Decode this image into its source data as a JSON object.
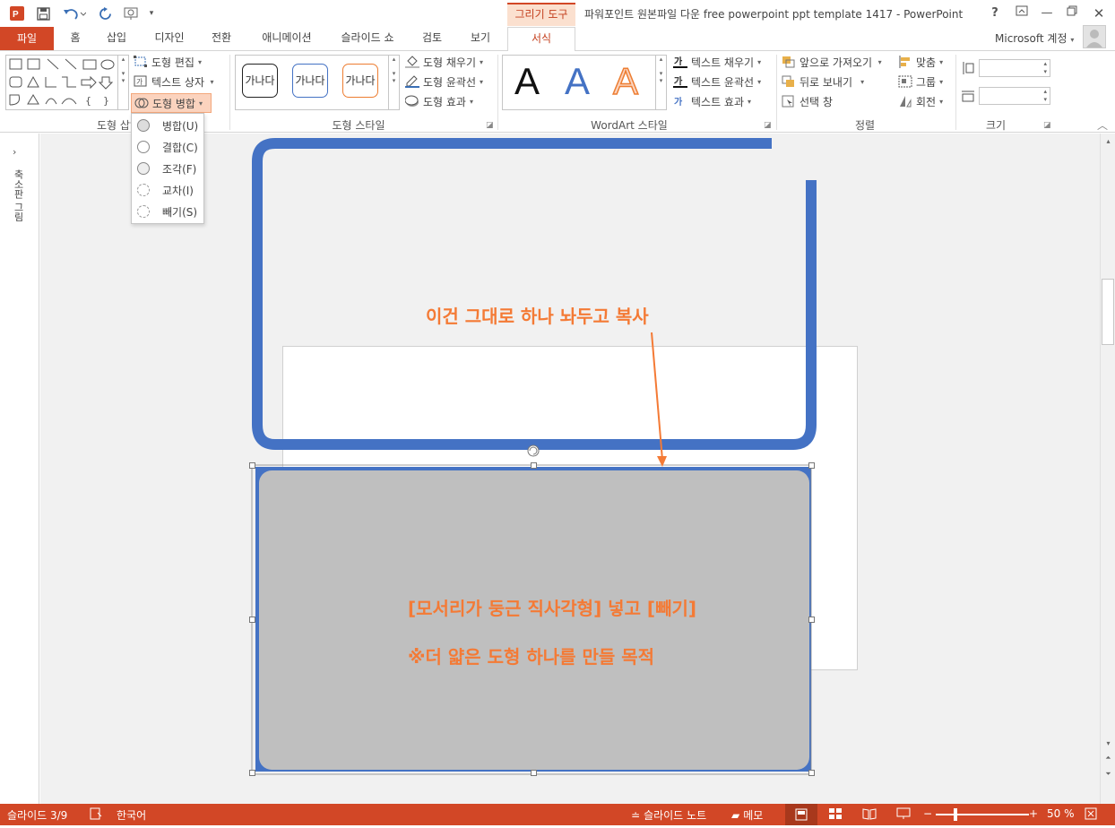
{
  "title_bar": {
    "window_title": "파워포인트 원본파일 다운 free powerpoint ppt template 1417 - PowerPoint",
    "context_group": "그리기 도구",
    "help": "?",
    "icons": [
      "powerpoint-logo-icon",
      "save-icon",
      "undo-icon",
      "redo-icon",
      "slideshow-icon"
    ]
  },
  "tabs": {
    "file": "파일",
    "items": [
      "홈",
      "삽입",
      "디자인",
      "전환",
      "애니메이션",
      "슬라이드 쇼",
      "검토",
      "보기"
    ],
    "format": "서식",
    "account": "Microsoft 계정"
  },
  "ribbon": {
    "insert_shapes": {
      "edit_shape": "도형 편집",
      "text_box": "텍스트 상자",
      "merge_shapes": "도형 병합",
      "label": "도형 삽입"
    },
    "shape_styles": {
      "samples": [
        "가나다",
        "가나다",
        "가나다"
      ],
      "fill": "도형 채우기",
      "outline": "도형 윤곽선",
      "effects": "도형 효과",
      "label": "도형 스타일"
    },
    "wordart": {
      "letters": [
        "A",
        "A",
        "A"
      ],
      "text_fill": "텍스트 채우기",
      "text_outline": "텍스트 윤곽선",
      "text_effects": "텍스트 효과",
      "label": "WordArt 스타일"
    },
    "arrange": {
      "bring_forward": "앞으로 가져오기",
      "send_backward": "뒤로 보내기",
      "selection_pane": "선택 창",
      "align": "맞춤",
      "group": "그룹",
      "rotate": "회전",
      "label": "정렬"
    },
    "size": {
      "label": "크기"
    }
  },
  "merge_menu": {
    "items": [
      "병합(U)",
      "결합(C)",
      "조각(F)",
      "교차(I)",
      "빼기(S)"
    ]
  },
  "thumbnail_pane": {
    "label": "축소판 그림"
  },
  "annotations": {
    "top": "이건 그대로 하나 놔두고 복사",
    "line1": "[모서리가 둥근 직사각형] 넣고 [빼기]",
    "line2": "※더 얇은 도형 하나를 만들 목적"
  },
  "status_bar": {
    "slide": "슬라이드 3/9",
    "language": "한국어",
    "notes": "슬라이드 노트",
    "comments": "메모",
    "zoom": "50 %"
  },
  "colors": {
    "accent": "#d24726",
    "shape_outline": "#4472c4",
    "shape_fill": "#bfbfbf",
    "annotation": "#f47a35"
  }
}
